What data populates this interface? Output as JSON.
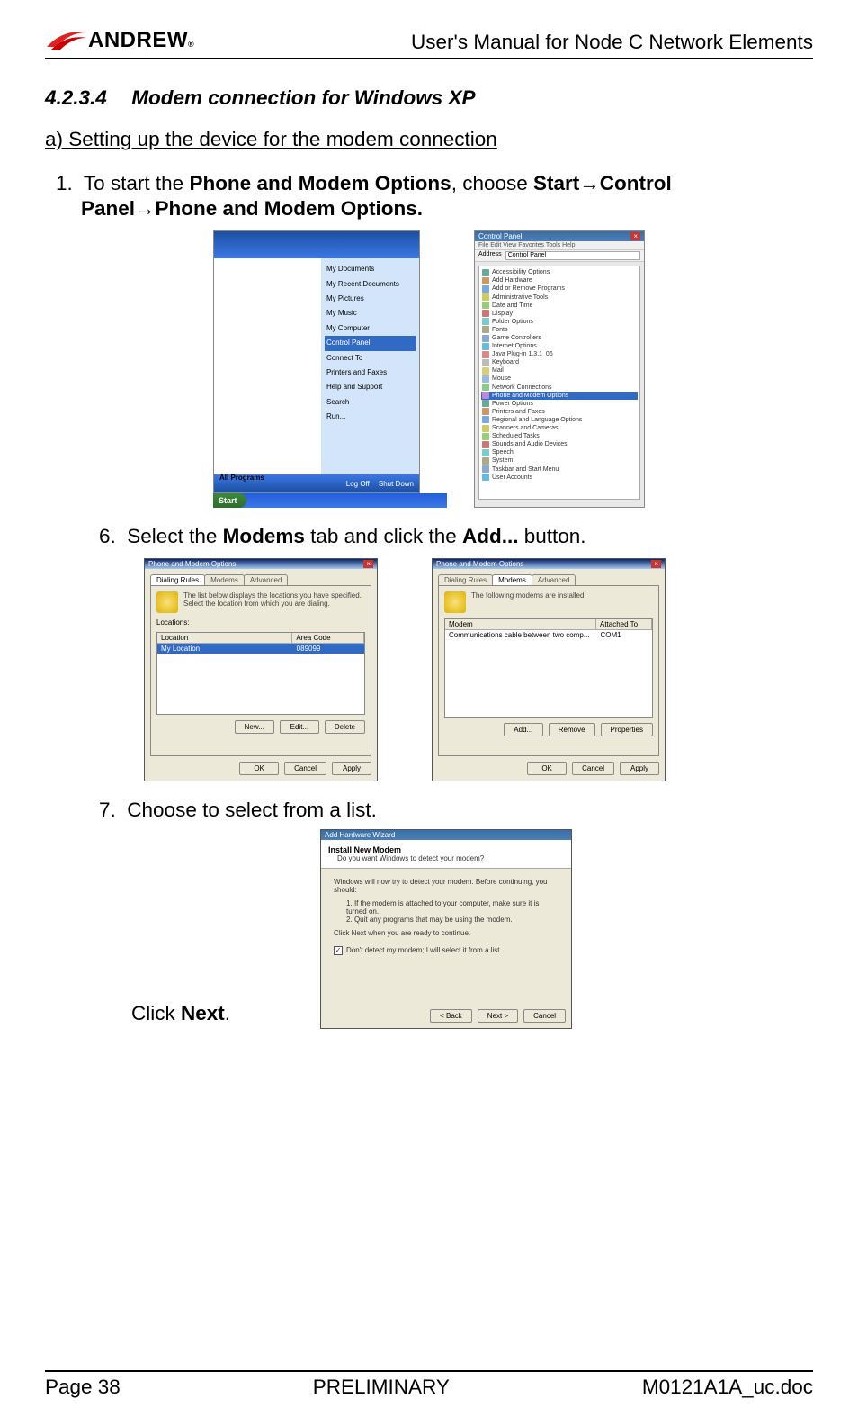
{
  "header": {
    "logo_text": "ANDREW",
    "logo_reg": "®",
    "doc_title": "User's Manual for Node C Network Elements"
  },
  "section": {
    "number": "4.2.3.4",
    "title": "Modem connection for Windows XP"
  },
  "subsection_a": "a) Setting up the device for the modem connection",
  "step1": {
    "num": "1.",
    "pre": "To start the ",
    "b1": "Phone and Modem Options",
    "mid1": ", choose ",
    "b2": "Start",
    "arrow1": "→",
    "b3": "Control Panel",
    "arrow2": "→",
    "b4": "Phone and Modem Options."
  },
  "start_menu": {
    "taskbar_start": "Start",
    "right": {
      "docs": "My Documents",
      "recent": "My Recent Documents",
      "pics": "My Pictures",
      "music": "My Music",
      "computer": "My Computer",
      "control_panel": "Control Panel",
      "connect": "Connect To",
      "printers": "Printers and Faxes",
      "help": "Help and Support",
      "search": "Search",
      "run": "Run..."
    },
    "bottom_logoff": "Log Off",
    "bottom_shutdown": "Shut Down",
    "all_programs": "All Programs"
  },
  "control_panel": {
    "title": "Control Panel",
    "menu": "File  Edit  View  Favorites  Tools  Help",
    "addr_label": "Address",
    "addr_value": "Control Panel",
    "items": [
      "Accessibility Options",
      "Add Hardware",
      "Add or Remove Programs",
      "Administrative Tools",
      "Date and Time",
      "Display",
      "Folder Options",
      "Fonts",
      "Game Controllers",
      "Internet Options",
      "Java Plug-in 1.3.1_06",
      "Keyboard",
      "Mail",
      "Mouse",
      "Network Connections",
      "Phone and Modem Options",
      "Power Options",
      "Printers and Faxes",
      "Regional and Language Options",
      "Scanners and Cameras",
      "Scheduled Tasks",
      "Sounds and Audio Devices",
      "Speech",
      "System",
      "Taskbar and Start Menu",
      "User Accounts"
    ],
    "highlight_index": 15
  },
  "step6": {
    "num": "6.",
    "pre": "Select the ",
    "b1": "Modems",
    "mid1": " tab and click the ",
    "b2": "Add...",
    "post": " button."
  },
  "dialog_dialing": {
    "title": "Phone and Modem Options",
    "tab1": "Dialing Rules",
    "tab2": "Modems",
    "tab3": "Advanced",
    "hint": "The list below displays the locations you have specified. Select the location from which you are dialing.",
    "label_locations": "Locations:",
    "col1": "Location",
    "col2": "Area Code",
    "row_loc": "My Location",
    "row_code": "089099",
    "btn_new": "New...",
    "btn_edit": "Edit...",
    "btn_delete": "Delete",
    "btn_ok": "OK",
    "btn_cancel": "Cancel",
    "btn_apply": "Apply"
  },
  "dialog_modems": {
    "title": "Phone and Modem Options",
    "hint": "The following modems are installed:",
    "col1": "Modem",
    "col2": "Attached To",
    "row_modem": "Communications cable between two comp...",
    "row_port": "COM1",
    "btn_add": "Add...",
    "btn_remove": "Remove",
    "btn_props": "Properties",
    "btn_ok": "OK",
    "btn_cancel": "Cancel",
    "btn_apply": "Apply"
  },
  "step7": {
    "num": "7.",
    "text": "Choose to select from a list.",
    "click_pre": "Click ",
    "click_bold": "Next",
    "click_post": "."
  },
  "wizard": {
    "title": "Add Hardware Wizard",
    "heading": "Install New Modem",
    "sub": "Do you want Windows to detect your modem?",
    "body1": "Windows will now try to detect your modem. Before continuing, you should:",
    "bullet1": "1. If the modem is attached to your computer, make sure it is turned on.",
    "bullet2": "2. Quit any programs that may be using the modem.",
    "body2": "Click Next when you are ready to continue.",
    "check_label": "Don't detect my modem; I will select it from a list.",
    "btn_back": "< Back",
    "btn_next": "Next >",
    "btn_cancel": "Cancel"
  },
  "footer": {
    "left": "Page 38",
    "center": "PRELIMINARY",
    "right": "M0121A1A_uc.doc"
  }
}
